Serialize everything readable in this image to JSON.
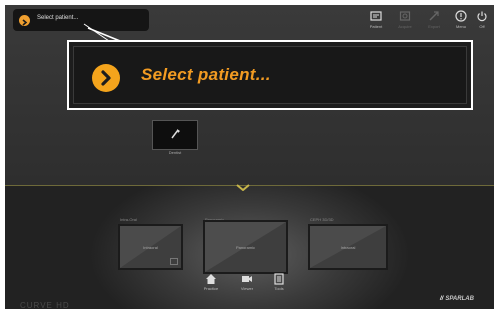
{
  "header": {
    "patient_pill_label": "Select patient...",
    "toolbar": [
      {
        "label": "Patient",
        "icon": "patient-card-icon",
        "enabled": true
      },
      {
        "label": "Acquire",
        "icon": "acquire-icon",
        "enabled": false
      },
      {
        "label": "Export",
        "icon": "export-icon",
        "enabled": false
      },
      {
        "label": "Menu",
        "icon": "menu-icon",
        "enabled": true
      },
      {
        "label": "Off",
        "icon": "power-icon",
        "enabled": true
      }
    ]
  },
  "callout": {
    "text": "Select patient..."
  },
  "doctor": {
    "label": "Dentist"
  },
  "slots": [
    {
      "header": "Intra-Oral",
      "text": "Intraoral"
    },
    {
      "header": "Panoramic",
      "text": "Panoramic"
    },
    {
      "header": "CEPH 3D/3D",
      "text": "Intraoral"
    }
  ],
  "bottom_buttons": [
    {
      "label": "Practice",
      "icon": "home-icon"
    },
    {
      "label": "Viewer",
      "icon": "camera-icon"
    },
    {
      "label": "Tools",
      "icon": "tools-icon"
    }
  ],
  "branding": {
    "product": "CURVE HD",
    "company": "SPARLAB"
  },
  "colors": {
    "accent": "#f29b22",
    "background_dark": "#2b2b2b",
    "callout_border": "#ffffff"
  }
}
